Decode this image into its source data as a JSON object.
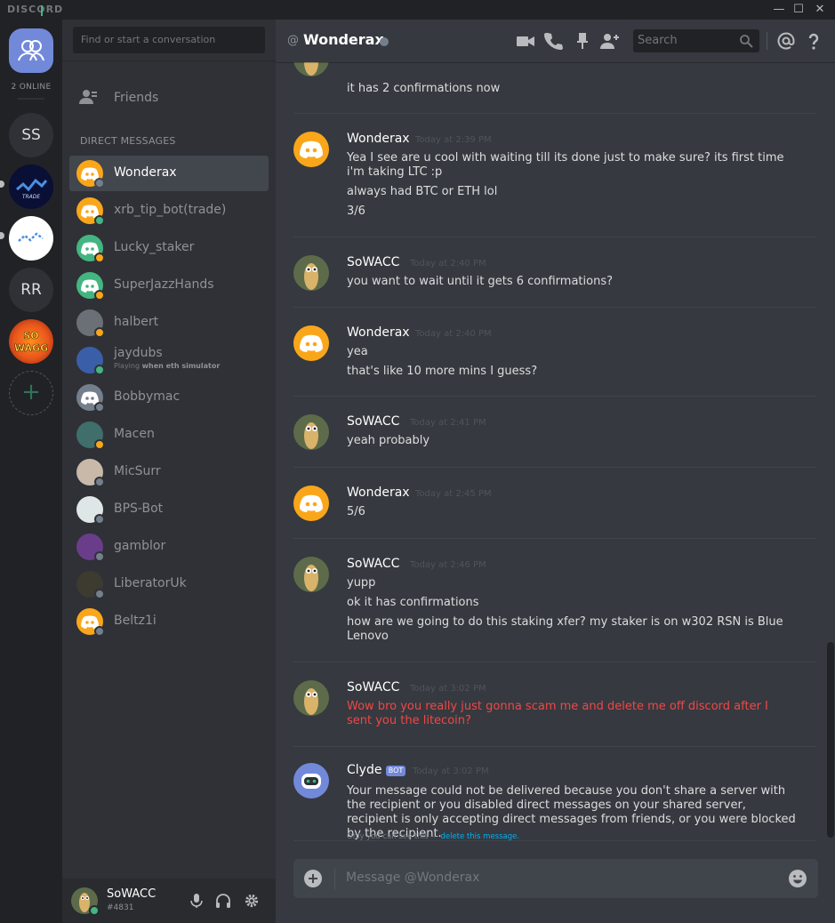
{
  "titlebar": {
    "logo": "DISCORD",
    "min": "—",
    "max": "☐",
    "close": "✕"
  },
  "rail": {
    "online_count": "2 ONLINE",
    "servers": [
      {
        "kind": "text",
        "label": "SS"
      },
      {
        "kind": "image",
        "label": "TRADE"
      },
      {
        "kind": "image",
        "label": ""
      },
      {
        "kind": "text",
        "label": "RR"
      },
      {
        "kind": "image",
        "label": "SO WAGG"
      }
    ],
    "add_icon": "+"
  },
  "dm": {
    "search_placeholder": "Find or start a conversation",
    "friends_label": "Friends",
    "header": "DIRECT MESSAGES",
    "items": [
      {
        "name": "Wonderax",
        "status": "offline",
        "avatar": "discord-orange",
        "active": true
      },
      {
        "name": "xrb_tip_bot(trade)",
        "status": "online",
        "avatar": "discord-orange"
      },
      {
        "name": "Lucky_staker",
        "status": "idle",
        "avatar": "discord-green"
      },
      {
        "name": "SuperJazzHands",
        "status": "idle",
        "avatar": "discord-green"
      },
      {
        "name": "halbert",
        "status": "idle",
        "avatar": "photo-gray"
      },
      {
        "name": "jaydubs",
        "status": "online",
        "avatar": "photo-blue",
        "activity_prefix": "Playing ",
        "activity_name": "when eth simulator"
      },
      {
        "name": "Bobbymac",
        "status": "offline",
        "avatar": "discord-gray"
      },
      {
        "name": "Macen",
        "status": "idle",
        "avatar": "photo-teal"
      },
      {
        "name": "MicSurr",
        "status": "offline",
        "avatar": "photo-light"
      },
      {
        "name": "BPS-Bot",
        "status": "offline",
        "avatar": "photo-white"
      },
      {
        "name": "gamblor",
        "status": "offline",
        "avatar": "photo-sunset"
      },
      {
        "name": "LiberatorUk",
        "status": "offline",
        "avatar": "photo-dark"
      },
      {
        "name": "Beltz1i",
        "status": "offline",
        "avatar": "discord-orange"
      }
    ]
  },
  "user_panel": {
    "username": "SoWACC",
    "discriminator": "#4831"
  },
  "chat": {
    "at_symbol": "@",
    "channel_name": "Wonderax",
    "search_placeholder": "Search",
    "composer_placeholder": "Message @Wonderax",
    "messages": {
      "m0": {
        "lines": [
          "it has 2 confirmations now"
        ]
      },
      "m1": {
        "author": "Wonderax",
        "timestamp": "Today at 2:39 PM",
        "lines": [
          "Yea  I see are u cool with waiting till its done just to make sure? its first time i'm taking LTC :p",
          "always had BTC or ETH lol",
          "3/6"
        ]
      },
      "m2": {
        "author": "SoWACC",
        "timestamp": "Today at 2:40 PM",
        "lines": [
          "you want to wait until it gets 6 confirmations?"
        ]
      },
      "m3": {
        "author": "Wonderax",
        "timestamp": "Today at 2:40 PM",
        "lines": [
          "yea",
          "that's like 10 more mins I guess?"
        ]
      },
      "m4": {
        "author": "SoWACC",
        "timestamp": "Today at 2:41 PM",
        "lines": [
          "yeah probably"
        ]
      },
      "m5": {
        "author": "Wonderax",
        "timestamp": "Today at 2:45 PM",
        "lines": [
          "5/6"
        ]
      },
      "m6": {
        "author": "SoWACC",
        "timestamp": "Today at 2:46 PM",
        "lines": [
          "yupp",
          "ok it has confirmations",
          "how are we going to do this staking xfer? my staker is on w302 RSN is Blue Lenovo"
        ]
      },
      "m7": {
        "author": "SoWACC",
        "timestamp": "Today at 3:02 PM",
        "lines": [
          "Wow bro you really just gonna scam me and delete me off discord after I sent you the litecoin?"
        ]
      },
      "m8": {
        "author": "Clyde",
        "bot_tag": "BOT",
        "timestamp": "Today at 3:02 PM",
        "lines": [
          "Your message could not be delivered because you don't share a server with the recipient or you disabled direct messages on your shared server, recipient is only accepting direct messages from friends, or you were blocked by the recipient."
        ],
        "note_prefix": "Only you can see this — ",
        "note_link": "delete this message."
      }
    }
  },
  "colors": {
    "blurple": "#7289da",
    "online": "#43b581",
    "idle": "#faa61a",
    "offline": "#747f8d",
    "danger": "#f04747",
    "link": "#00b0f4"
  }
}
